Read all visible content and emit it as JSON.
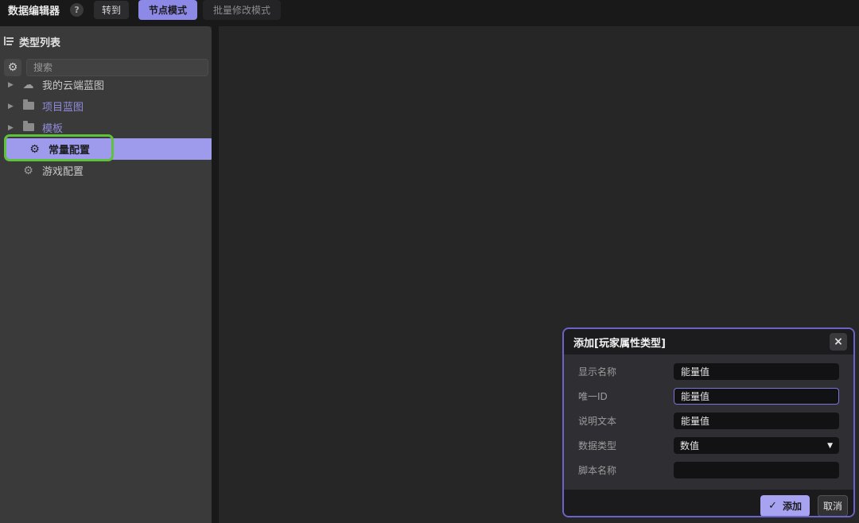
{
  "icons": {
    "help": "?",
    "gear": "⚙",
    "cloud": "☁",
    "chevron": "▶",
    "caret": "▼",
    "check": "✓",
    "close": "×"
  },
  "topbar": {
    "app_title": "数据编辑器",
    "goto_button": "转到",
    "tabs": [
      {
        "label": "节点模式",
        "active": true
      },
      {
        "label": "批量修改模式",
        "active": false
      }
    ]
  },
  "sidebar": {
    "header": "类型列表",
    "search": {
      "placeholder": "搜索"
    },
    "tree": [
      {
        "label": "我的云端蓝图",
        "icon": "cloud",
        "expandable": true,
        "selected": false
      },
      {
        "label": "项目蓝图",
        "icon": "folder",
        "expandable": true,
        "selected": false
      },
      {
        "label": "模板",
        "icon": "folder",
        "expandable": true,
        "selected": false
      },
      {
        "label": "常量配置",
        "icon": "gear",
        "expandable": false,
        "selected": true,
        "annotated": true
      },
      {
        "label": "游戏配置",
        "icon": "gear",
        "expandable": false,
        "selected": false
      }
    ]
  },
  "dialog": {
    "title": "添加[玩家属性类型]",
    "fields": [
      {
        "label": "显示名称",
        "value": "能量值",
        "type": "text"
      },
      {
        "label": "唯一ID",
        "value": "能量值",
        "type": "text",
        "focused": true
      },
      {
        "label": "说明文本",
        "value": "能量值",
        "type": "text"
      },
      {
        "label": "数据类型",
        "value": "数值",
        "type": "select"
      },
      {
        "label": "脚本名称",
        "value": "",
        "type": "text"
      }
    ],
    "buttons": {
      "confirm": "添加",
      "cancel": "取消"
    }
  },
  "colors": {
    "accent_purple": "#8d89e6",
    "selection_purple": "#9e9bed",
    "annotation_green": "#5ec23a",
    "dialog_border": "#6b64c8",
    "sidebar_bg": "#3a3a3a",
    "topbar_bg": "#191919",
    "canvas_bg": "#262626"
  }
}
